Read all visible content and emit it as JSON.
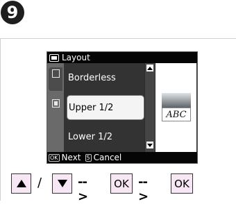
{
  "step": {
    "number": "9"
  },
  "screen": {
    "title": "Layout",
    "items": [
      {
        "label": "Borderless",
        "selected": false
      },
      {
        "label": "Upper 1/2",
        "selected": true
      },
      {
        "label": "Lower 1/2",
        "selected": false
      }
    ],
    "preview_text": "ABC",
    "softkeys": {
      "next_key": "OK",
      "next_label": "Next",
      "cancel_key": "5",
      "cancel_label": "Cancel"
    }
  },
  "nav": {
    "slash": "/",
    "arrow1": "-->",
    "arrow2": "-->",
    "ok1": "OK",
    "ok2": "OK"
  },
  "colors": {
    "button_fill": "#f7e6f4",
    "screen_bg": "#2b2b2b",
    "bar_bg": "#050505"
  }
}
